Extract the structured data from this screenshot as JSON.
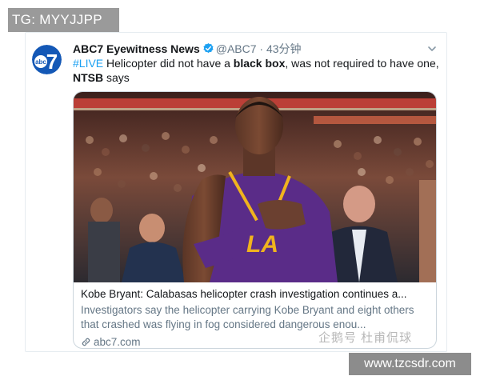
{
  "overlay": {
    "tg_label": "TG: MYYJJPP",
    "watermark_cn": "企鹅号 杜甫侃球",
    "site_url": "www.tzcsdr.com"
  },
  "tweet": {
    "avatar_text": "abc",
    "avatar_number": "7",
    "display_name": "ABC7 Eyewitness News",
    "handle": "@ABC7",
    "separator": "·",
    "time": "43分钟",
    "text_parts": {
      "hashtag": "#LIVE",
      "t1": " Helicopter did not have a ",
      "b1": "black box",
      "t2": ", was not required to have one, ",
      "b2": "NTSB",
      "t3": " says"
    },
    "card": {
      "jersey_text": "LA",
      "title": "Kobe Bryant: Calabasas helicopter crash investigation continues a...",
      "description": "Investigators say the helicopter carrying Kobe Bryant and eight others that crashed was flying in fog considered dangerous enou...",
      "domain": "abc7.com"
    }
  },
  "colors": {
    "brand_blue": "#1da1f2",
    "abc7_blue": "#1458b6",
    "laker_purple": "#5a2c88",
    "laker_gold": "#f0b31e"
  },
  "icons": [
    "abc7-logo",
    "verified-badge-icon",
    "chevron-down-icon",
    "link-icon"
  ]
}
